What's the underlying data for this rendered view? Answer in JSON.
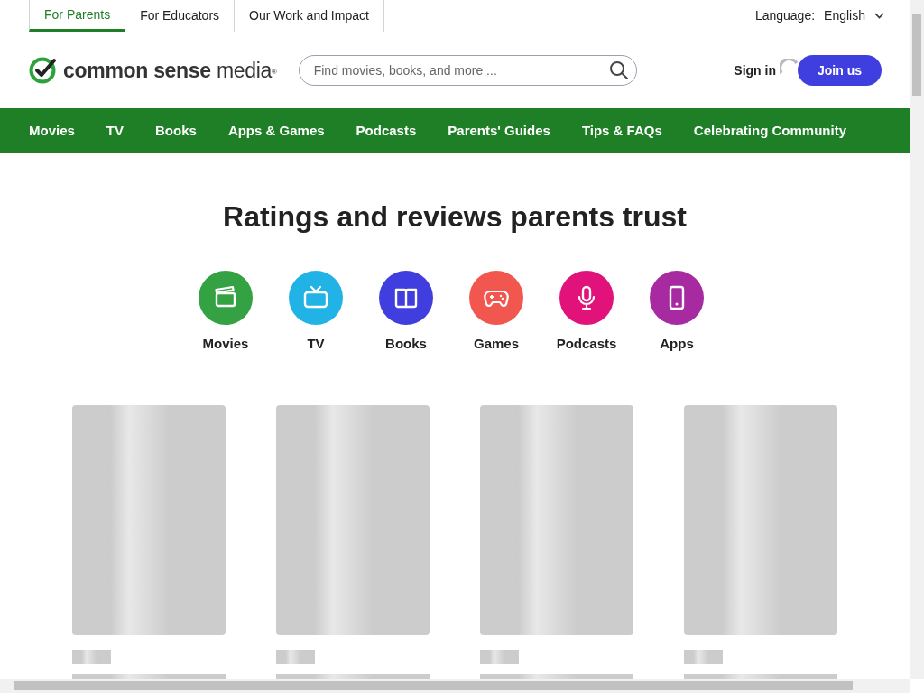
{
  "top_tabs": [
    {
      "label": "For Parents",
      "selected": true
    },
    {
      "label": "For Educators",
      "selected": false
    },
    {
      "label": "Our Work and Impact",
      "selected": false
    }
  ],
  "language": {
    "label": "Language:",
    "value": "English"
  },
  "logo": {
    "text": "**common sense** media$^{®}$"
  },
  "search": {
    "placeholder": "Find movies, books, and more ..."
  },
  "sign_in": "Sign in",
  "join_button": "Join us",
  "nav": [
    "Movies",
    "TV",
    "Books",
    "Apps & Games",
    "Podcasts",
    "Parents' Guides",
    "Tips & FAQs",
    "Celebrating Community"
  ],
  "heading": "Ratings and reviews parents trust",
  "categories": [
    {
      "label": "Movies",
      "color": "#34a243"
    },
    {
      "label": "TV",
      "color": "#22b3e6"
    },
    {
      "label": "Books",
      "color": "#413ee0"
    },
    {
      "label": "Games",
      "color": "#f2574f"
    },
    {
      "label": "Podcasts",
      "color": "#e1127a"
    },
    {
      "label": "Apps",
      "color": "#a72aa1"
    }
  ]
}
